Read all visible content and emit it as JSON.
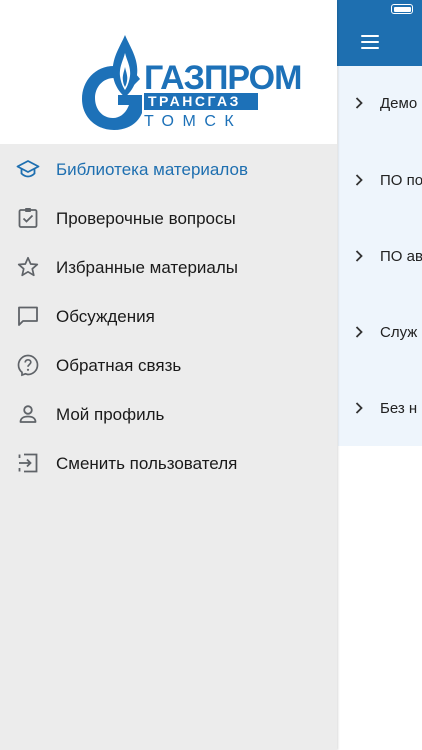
{
  "colors": {
    "accent": "#1e6fb0",
    "drawer_bg": "#ececec",
    "header_bg": "#ffffff",
    "list_bg": "#eef5fc",
    "icon_gray": "#5f6368"
  },
  "logo": {
    "line1": "ГАЗПРОМ",
    "line2": "ТРАНСГАЗ",
    "line3": "ТОМСК"
  },
  "drawer": {
    "items": [
      {
        "label": "Библиотека материалов",
        "icon": "graduation-cap-icon",
        "active": true
      },
      {
        "label": "Проверочные вопросы",
        "icon": "clipboard-check-icon",
        "active": false
      },
      {
        "label": "Избранные материалы",
        "icon": "star-icon",
        "active": false
      },
      {
        "label": "Обсуждения",
        "icon": "chat-bubble-icon",
        "active": false
      },
      {
        "label": "Обратная связь",
        "icon": "help-circle-icon",
        "active": false
      },
      {
        "label": "Мой профиль",
        "icon": "person-icon",
        "active": false
      },
      {
        "label": "Сменить пользователя",
        "icon": "logout-icon",
        "active": false
      }
    ]
  },
  "main": {
    "categories": [
      {
        "label": "Демо"
      },
      {
        "label": "ПО по"
      },
      {
        "label": "ПО ав"
      },
      {
        "label": "Служ"
      },
      {
        "label": "Без н"
      }
    ]
  }
}
